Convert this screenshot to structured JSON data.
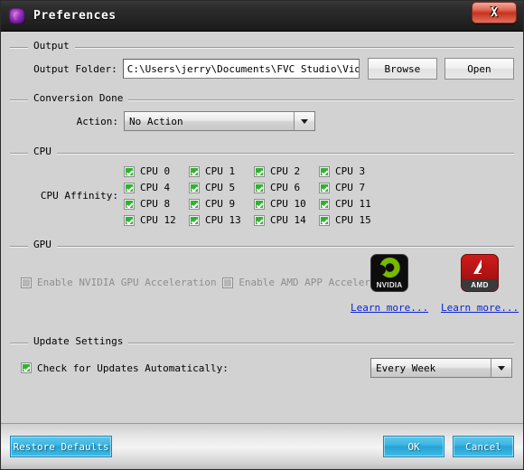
{
  "window": {
    "title": "Preferences",
    "icon": "app-swirl-icon",
    "close_label": "X"
  },
  "output": {
    "group_label": "Output",
    "folder_label": "Output Folder:",
    "folder_value": "C:\\Users\\jerry\\Documents\\FVC Studio\\Video",
    "browse_label": "Browse",
    "open_label": "Open"
  },
  "conversion_done": {
    "group_label": "Conversion Done",
    "action_label": "Action:",
    "action_value": "No Action"
  },
  "cpu": {
    "group_label": "CPU",
    "affinity_label": "CPU Affinity:",
    "items": [
      {
        "label": "CPU 0",
        "checked": true
      },
      {
        "label": "CPU 1",
        "checked": true
      },
      {
        "label": "CPU 2",
        "checked": true
      },
      {
        "label": "CPU 3",
        "checked": true
      },
      {
        "label": "CPU 4",
        "checked": true
      },
      {
        "label": "CPU 5",
        "checked": true
      },
      {
        "label": "CPU 6",
        "checked": true
      },
      {
        "label": "CPU 7",
        "checked": true
      },
      {
        "label": "CPU 8",
        "checked": true
      },
      {
        "label": "CPU 9",
        "checked": true
      },
      {
        "label": "CPU 10",
        "checked": true
      },
      {
        "label": "CPU 11",
        "checked": true
      },
      {
        "label": "CPU 12",
        "checked": true
      },
      {
        "label": "CPU 13",
        "checked": true
      },
      {
        "label": "CPU 14",
        "checked": true
      },
      {
        "label": "CPU 15",
        "checked": true
      }
    ]
  },
  "gpu": {
    "group_label": "GPU",
    "nvidia_label": "Enable NVIDIA GPU Acceleration",
    "nvidia_checked": false,
    "nvidia_disabled": true,
    "amd_label": "Enable AMD APP Acceleration",
    "amd_checked": false,
    "amd_disabled": true,
    "nvidia_logo_text": "NVIDIA",
    "amd_logo_text": "AMD",
    "nvidia_learn_more": "Learn more...",
    "amd_learn_more": "Learn more..."
  },
  "update_settings": {
    "group_label": "Update Settings",
    "check_label": "Check for Updates Automatically:",
    "check_checked": true,
    "frequency_value": "Every Week"
  },
  "footer": {
    "restore_label": "Restore Defaults",
    "ok_label": "OK",
    "cancel_label": "Cancel"
  },
  "colors": {
    "titlebar": "#262626",
    "dialog_bg": "#d2d2d2",
    "accent_blue": "#24a3d6",
    "checkbox_green": "#2fb32f",
    "link_blue": "#0a24d8",
    "close_red": "#c8321e",
    "nvidia_green": "#76b900",
    "amd_red": "#cf1b1b"
  }
}
